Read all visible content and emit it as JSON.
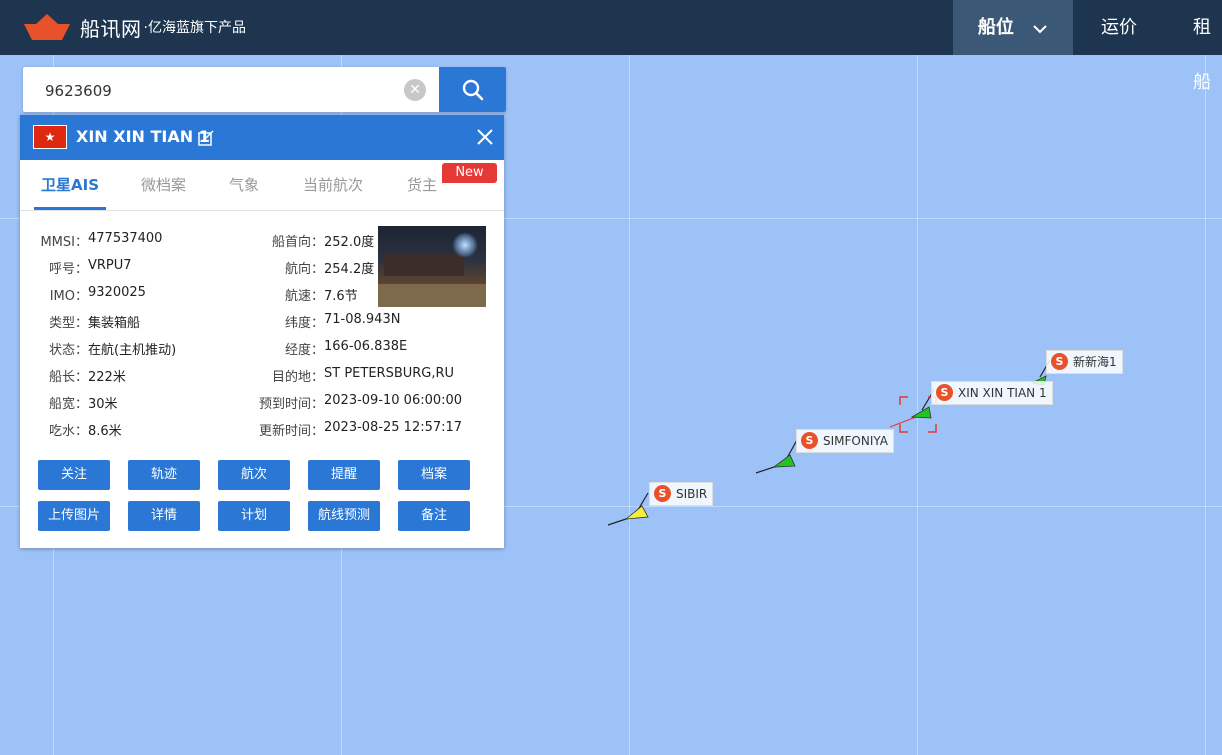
{
  "header": {
    "brand": "船讯网",
    "brand_sub": "·亿海蓝旗下产品",
    "nav": [
      {
        "label": "船位"
      },
      {
        "label": "运价"
      },
      {
        "label": "租船"
      }
    ]
  },
  "search": {
    "value": "9623609"
  },
  "vessel": {
    "name": "XIN XIN TIAN 1",
    "flag_star": "★",
    "tabs": [
      {
        "label": "卫星AIS"
      },
      {
        "label": "微档案"
      },
      {
        "label": "气象"
      },
      {
        "label": "当前航次"
      },
      {
        "label": "货主"
      }
    ],
    "new_badge": "New",
    "left_fields": [
      {
        "label": "MMSI：",
        "value": "477537400"
      },
      {
        "label": "呼号：",
        "value": "VRPU7"
      },
      {
        "label": "IMO：",
        "value": "9320025"
      },
      {
        "label": "类型：",
        "value": "集装箱船"
      },
      {
        "label": "状态：",
        "value": "在航(主机推动)"
      },
      {
        "label": "船长：",
        "value": "222米"
      },
      {
        "label": "船宽：",
        "value": "30米"
      },
      {
        "label": "吃水：",
        "value": "8.6米"
      }
    ],
    "right_fields": [
      {
        "label": "船首向：",
        "value": "252.0度"
      },
      {
        "label": "航向：",
        "value": "254.2度"
      },
      {
        "label": "航速：",
        "value": "7.6节"
      },
      {
        "label": "纬度：",
        "value": "71-08.943N"
      },
      {
        "label": "经度：",
        "value": "166-06.838E"
      },
      {
        "label": "目的地：",
        "value": "ST PETERSBURG,RU"
      },
      {
        "label": "预到时间：",
        "value": "2023-09-10 06:00:00"
      },
      {
        "label": "更新时间：",
        "value": "2023-08-25 12:57:17"
      }
    ],
    "buttons_row1": [
      "关注",
      "轨迹",
      "航次",
      "提醒",
      "档案"
    ],
    "buttons_row2": [
      "上传图片",
      "详情",
      "计划",
      "航线预测",
      "备注"
    ]
  },
  "map_ships": [
    {
      "name": "新新海1",
      "color": "#22c322"
    },
    {
      "name": "XIN XIN TIAN 1",
      "color": "#22c322"
    },
    {
      "name": "SIMFONIYA",
      "color": "#22c322"
    },
    {
      "name": "SIBIR",
      "color": "#f5ef3a"
    }
  ],
  "ship_badge": "S",
  "colors": {
    "topbar": "#1e3550",
    "accent": "#2a77d6",
    "map_water": "#9dc2f8",
    "badge_red": "#e53935",
    "ship_marker_orange": "#e8522b"
  }
}
